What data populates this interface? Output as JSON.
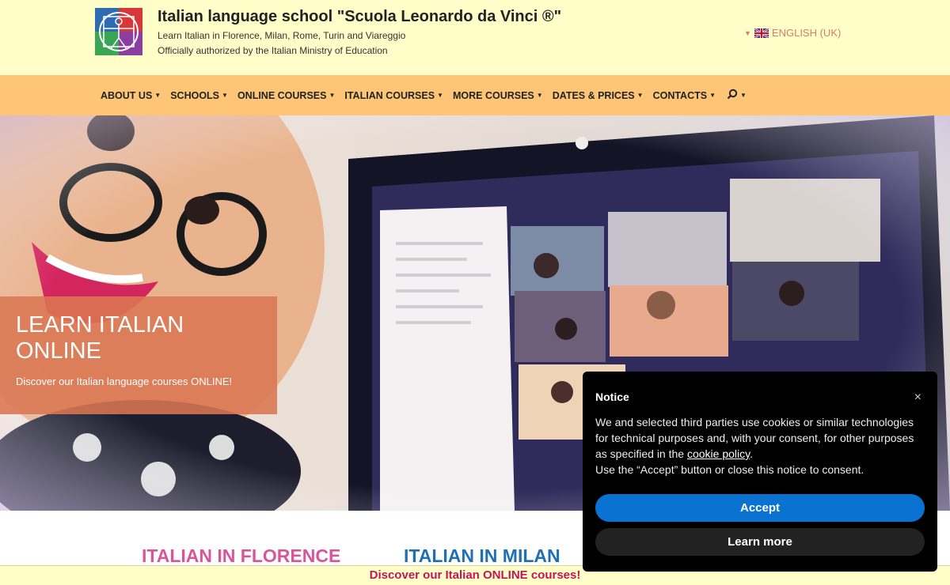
{
  "header": {
    "title": "Italian language school \"Scuola Leonardo da Vinci ®\"",
    "subtitle": "Learn Italian in Florence, Milan, Rome, Turin and Viareggio",
    "subtitle2": "Officially authorized by the Italian Ministry of Education",
    "language": "ENGLISH (UK)",
    "logo_icon": "vitruvian-man-logo"
  },
  "nav": {
    "items": [
      {
        "label": "ABOUT US"
      },
      {
        "label": "SCHOOLS"
      },
      {
        "label": "ONLINE COURSES"
      },
      {
        "label": "ITALIAN COURSES"
      },
      {
        "label": "MORE COURSES"
      },
      {
        "label": "DATES & PRICES"
      },
      {
        "label": "CONTACTS"
      }
    ],
    "search_icon": "search-icon"
  },
  "hero": {
    "title": "LEARN ITALIAN ONLINE",
    "text": "Discover our Italian language courses ONLINE!"
  },
  "cities": {
    "florence": "ITALIAN IN FLORENCE",
    "milan": "ITALIAN IN MILAN"
  },
  "banner": {
    "text": "Discover our Italian ONLINE courses!"
  },
  "notice": {
    "title": "Notice",
    "body_before": "We and selected third parties use cookies or similar technologies for technical purposes and, with your consent, for other purposes as specified in the ",
    "link": "cookie policy",
    "body_after": ".",
    "body_line2": "Use the “Accept” button or close this notice to consent.",
    "accept": "Accept",
    "learn_more": "Learn more",
    "close": "×"
  },
  "colors": {
    "header_bg": "#fffdc8",
    "nav_bg": "#fdc575",
    "hero_box": "#da7652",
    "florence": "#d9559a",
    "milan": "#1f6fb7",
    "banner_text": "#c0165a",
    "accept_button": "#0a73d1"
  }
}
